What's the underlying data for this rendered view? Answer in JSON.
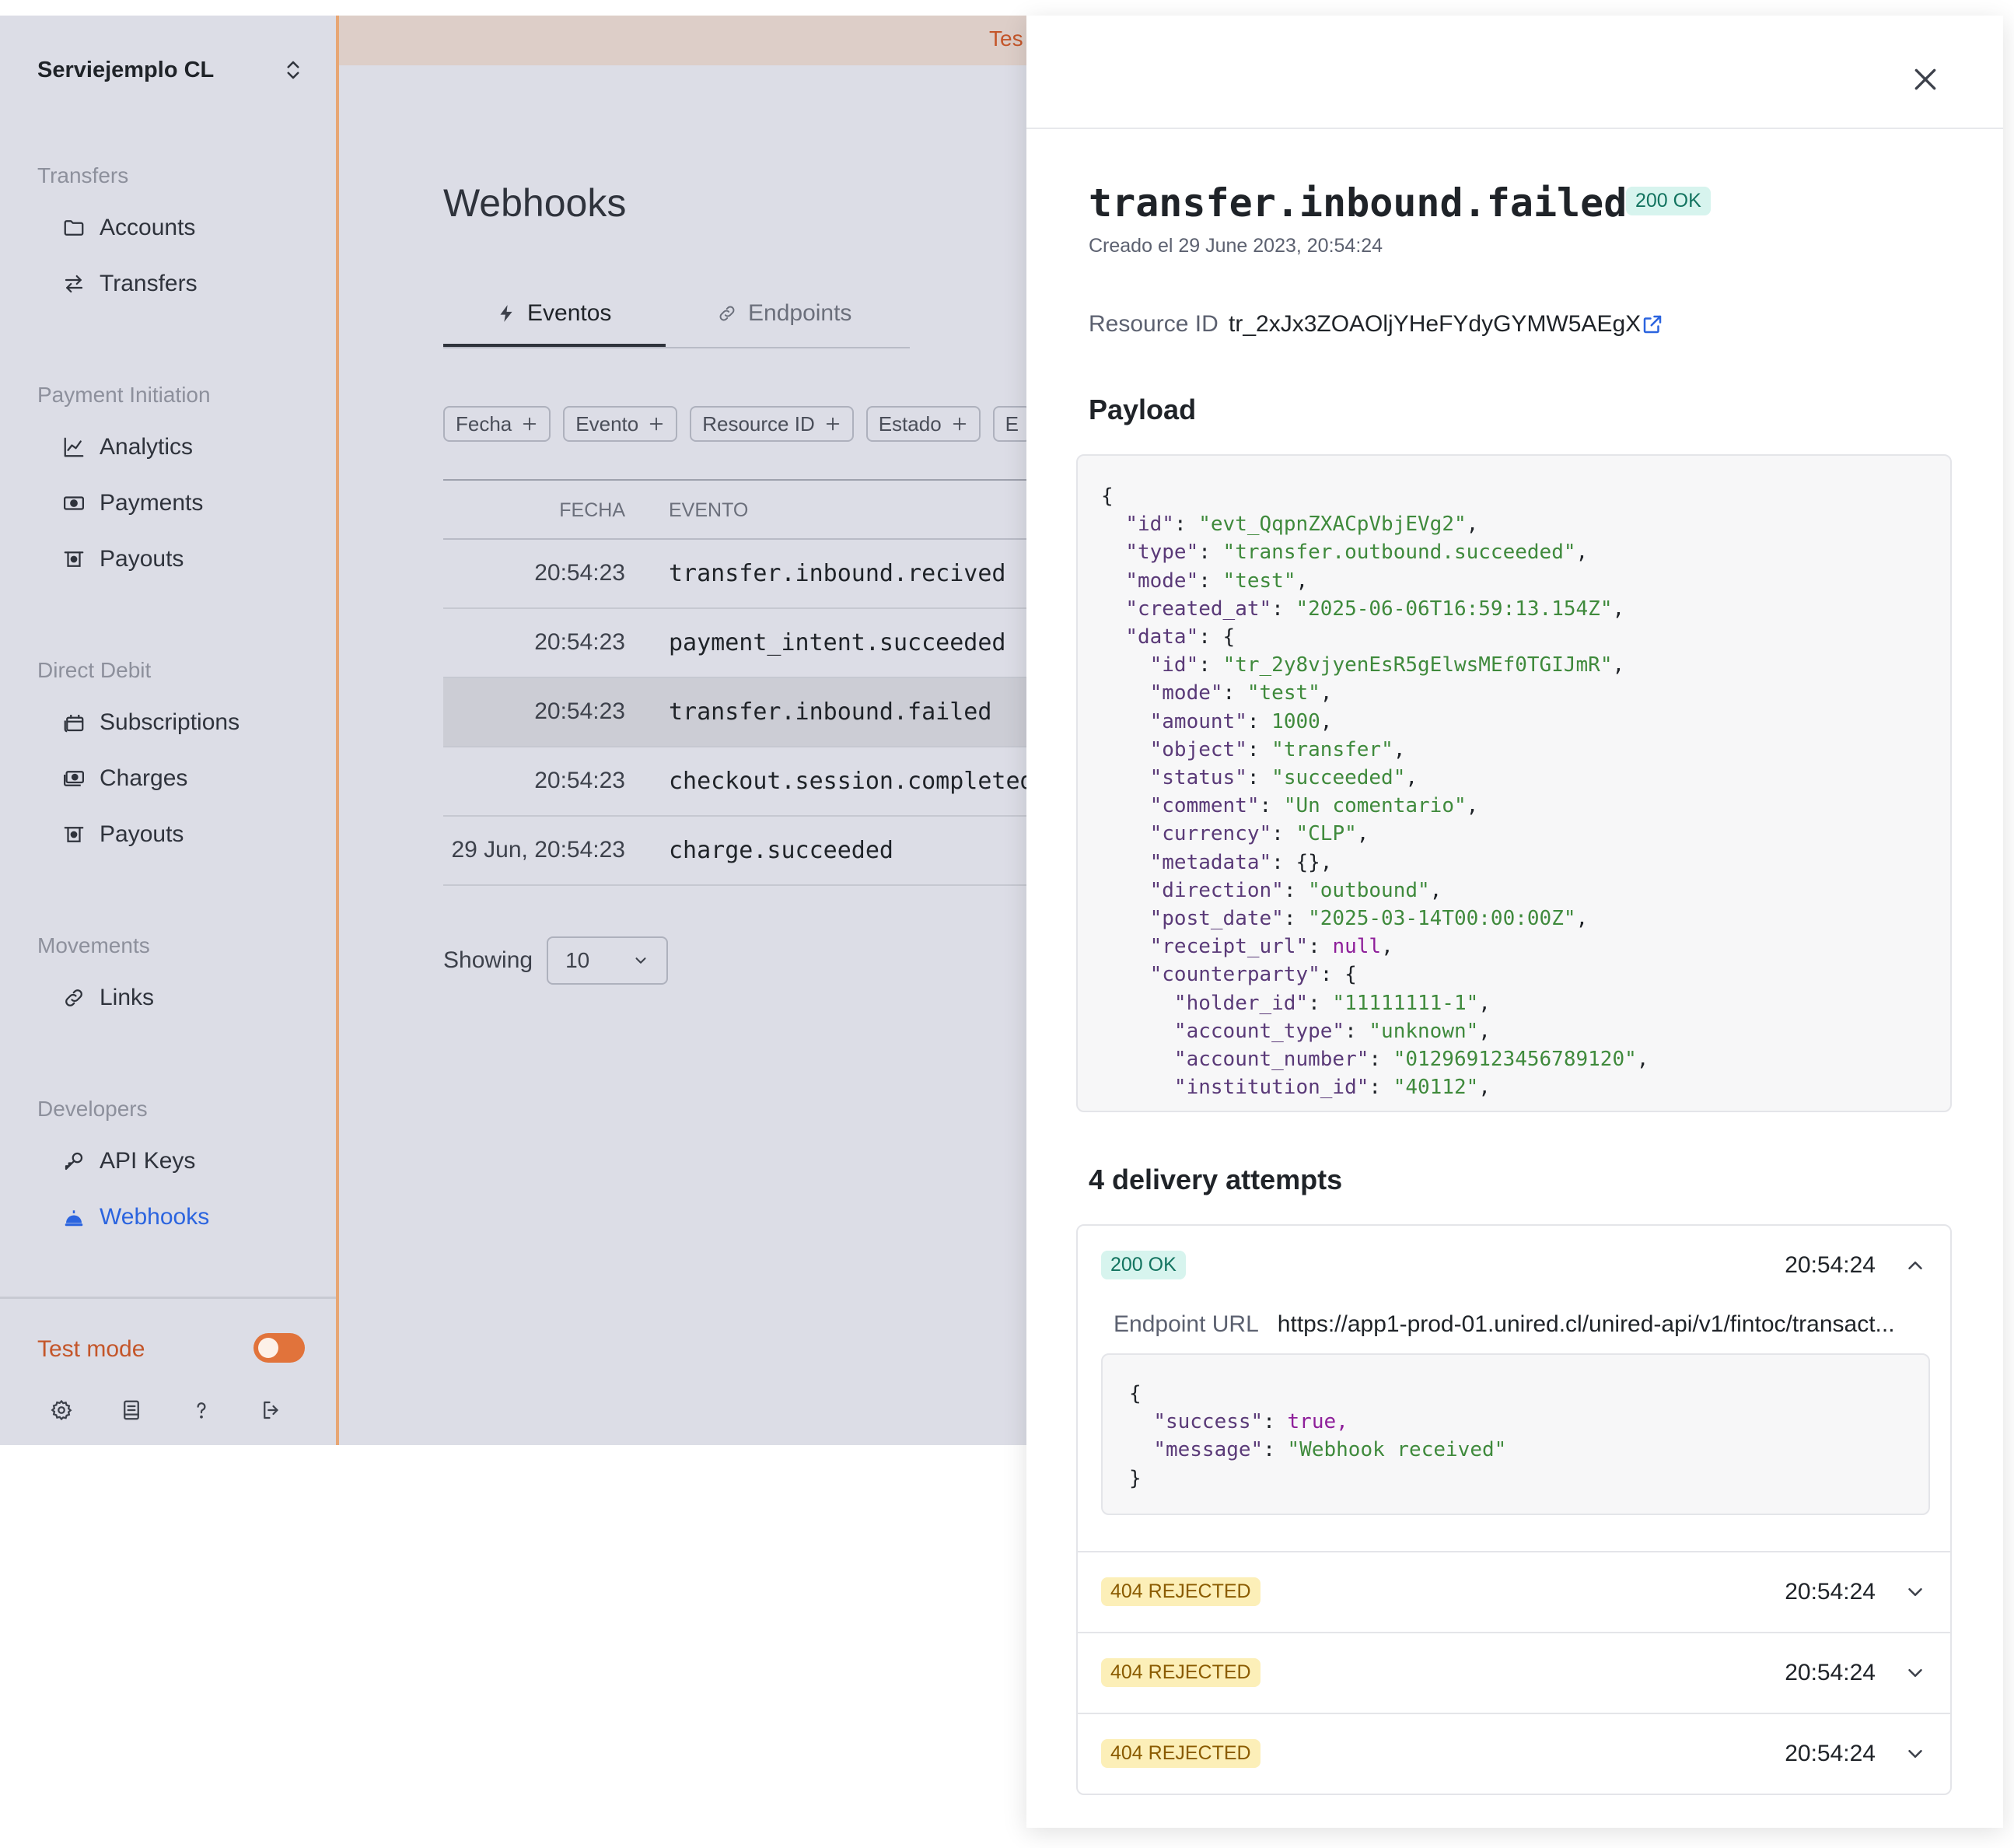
{
  "sidebar": {
    "org": "Serviejemplo CL",
    "sections": [
      {
        "title": "Transfers",
        "items": [
          {
            "label": "Accounts",
            "icon": "folder-icon"
          },
          {
            "label": "Transfers",
            "icon": "arrows-swap-icon"
          }
        ]
      },
      {
        "title": "Payment Initiation",
        "items": [
          {
            "label": "Analytics",
            "icon": "chart-line-icon"
          },
          {
            "label": "Payments",
            "icon": "cash-icon"
          },
          {
            "label": "Payouts",
            "icon": "payout-icon"
          }
        ]
      },
      {
        "title": "Direct Debit",
        "items": [
          {
            "label": "Subscriptions",
            "icon": "calendar-stack-icon"
          },
          {
            "label": "Charges",
            "icon": "cash-stack-icon"
          },
          {
            "label": "Payouts",
            "icon": "payout-icon"
          }
        ]
      },
      {
        "title": "Movements",
        "items": [
          {
            "label": "Links",
            "icon": "link-icon"
          }
        ]
      },
      {
        "title": "Developers",
        "items": [
          {
            "label": "API Keys",
            "icon": "key-icon"
          },
          {
            "label": "Webhooks",
            "icon": "bell-icon",
            "active": true
          }
        ]
      }
    ],
    "test_mode": "Test mode",
    "test_mode_on": true,
    "bottom_icons": [
      "settings-icon",
      "docs-icon",
      "help-icon",
      "logout-icon"
    ]
  },
  "banner": {
    "text": "Tes"
  },
  "main": {
    "title": "Webhooks",
    "tabs": [
      {
        "label": "Eventos",
        "icon": "bolt-icon",
        "active": true
      },
      {
        "label": "Endpoints",
        "icon": "link-icon",
        "active": false
      }
    ],
    "filters": [
      "Fecha",
      "Evento",
      "Resource ID",
      "Estado",
      "E"
    ],
    "table": {
      "headers": {
        "fecha": "FECHA",
        "evento": "EVENTO"
      },
      "rows": [
        {
          "time": "20:54:23",
          "event": "transfer.inbound.recived"
        },
        {
          "time": "20:54:23",
          "event": "payment_intent.succeeded"
        },
        {
          "time": "20:54:23",
          "event": "transfer.inbound.failed",
          "selected": true
        },
        {
          "time": "20:54:23",
          "event": "checkout.session.completed"
        },
        {
          "time": "29 Jun, 20:54:23",
          "event": "charge.succeeded"
        }
      ]
    },
    "showing_label": "Showing",
    "showing_value": "10"
  },
  "detail": {
    "event": "transfer.inbound.failed",
    "status_badge": "200 OK",
    "created": "Creado el 29 June 2023, 20:54:24",
    "resource_id_label": "Resource ID",
    "resource_id": "tr_2xJx3ZOAOljYHeFYdyGYMW5AEgX",
    "payload_title": "Payload",
    "payload": {
      "id": "evt_QqpnZXACpVbjEVg2",
      "type": "transfer.outbound.succeeded",
      "mode": "test",
      "created_at": "2025-06-06T16:59:13.154Z",
      "data": {
        "id": "tr_2y8vjyenEsR5gElwsMEf0TGIJmR",
        "mode": "test",
        "amount": 1000,
        "object": "transfer",
        "status": "succeeded",
        "comment": "Un comentario",
        "currency": "CLP",
        "metadata": "{}",
        "direction": "outbound",
        "post_date": "2025-03-14T00:00:00Z",
        "receipt_url": "null",
        "counterparty": {
          "holder_id": "11111111-1",
          "account_type": "unknown",
          "account_number": "012969123456789120",
          "institution_id": "40112"
        }
      }
    },
    "attempts_title": "4 delivery attempts",
    "attempts": [
      {
        "status": "200 OK",
        "type": "ok",
        "time": "20:54:24",
        "expanded": true,
        "endpoint_label": "Endpoint URL",
        "endpoint_url": "https://app1-prod-01.unired.cl/unired-api/v1/fintoc/transact...",
        "response": {
          "success": "true",
          "message": "Webhook received"
        }
      },
      {
        "status": "404 REJECTED",
        "type": "rejected",
        "time": "20:54:24",
        "expanded": false
      },
      {
        "status": "404 REJECTED",
        "type": "rejected",
        "time": "20:54:24",
        "expanded": false
      },
      {
        "status": "404 REJECTED",
        "type": "rejected",
        "time": "20:54:24",
        "expanded": false
      }
    ]
  }
}
